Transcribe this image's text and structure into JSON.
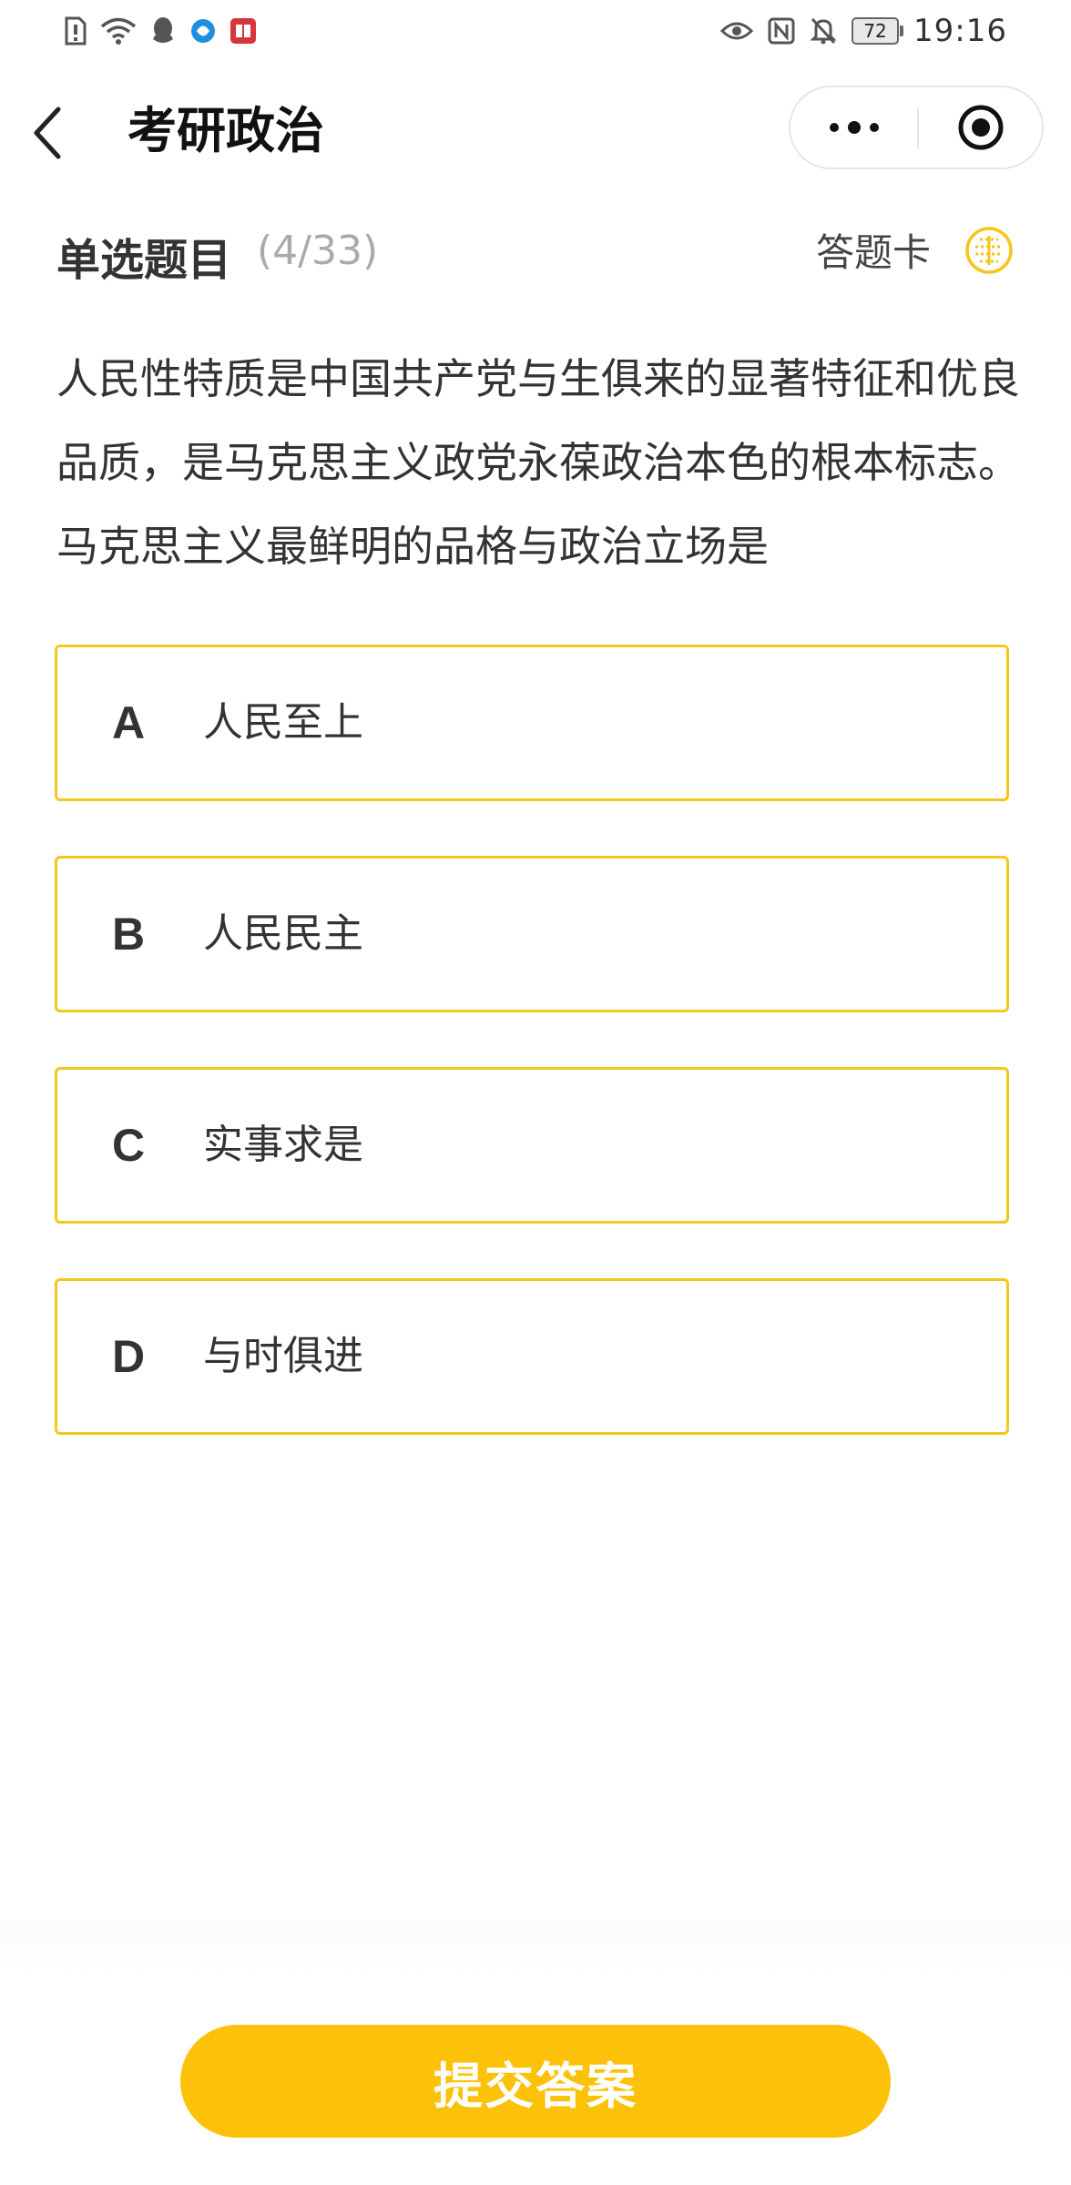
{
  "status_bar": {
    "time": "19:16",
    "battery": "72",
    "left_icons": [
      "sim-alert-icon",
      "wifi-icon",
      "qq-icon",
      "browser-icon",
      "book-app-icon"
    ],
    "right_icons": [
      "eye-icon",
      "nfc-icon",
      "mute-icon"
    ]
  },
  "nav": {
    "title": "考研政治"
  },
  "question": {
    "type": "单选题目",
    "progress": "(4/33)",
    "answer_card_label": "答题卡",
    "stem": "人民性特质是中国共产党与生俱来的显著特征和优良品质，是马克思主义政党永葆政治本色的根本标志。马克思主义最鲜明的品格与政治立场是",
    "options": [
      {
        "letter": "A",
        "text": "人民至上"
      },
      {
        "letter": "B",
        "text": "人民民主"
      },
      {
        "letter": "C",
        "text": "实事求是"
      },
      {
        "letter": "D",
        "text": "与时俱进"
      }
    ]
  },
  "footer": {
    "submit_label": "提交答案"
  },
  "colors": {
    "accent": "#fcc20a",
    "option_border": "#f2c81c",
    "progress_gray": "#aaaaaa",
    "text": "#333333"
  }
}
